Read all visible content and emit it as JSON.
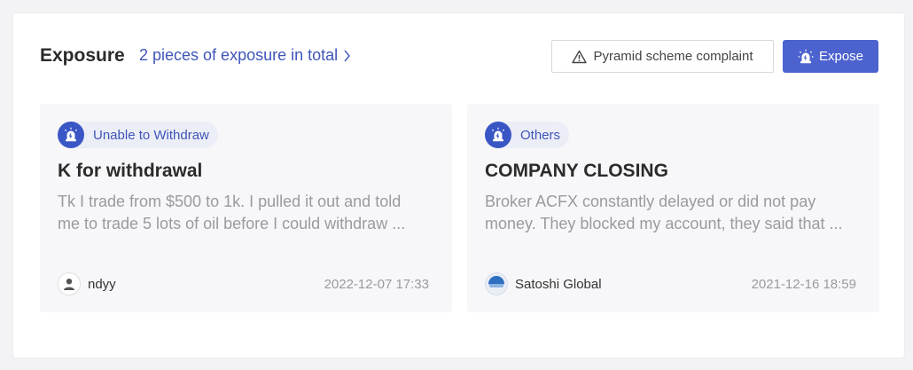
{
  "header": {
    "title": "Exposure",
    "count_link": "2 pieces of exposure in total",
    "complaint_button": "Pyramid scheme complaint",
    "expose_button": "Expose"
  },
  "cards": [
    {
      "tag": "Unable to Withdraw",
      "title": "K for withdrawal",
      "body_line1": "Tk I trade from $500 to 1k. I pulled it out and told",
      "body_line2": "me to trade 5 lots of oil before I could withdraw ...",
      "author": "ndyy",
      "date": "2022-12-07 17:33"
    },
    {
      "tag": "Others",
      "title": "COMPANY CLOSING",
      "body_line1": "Broker ACFX constantly delayed or did not pay",
      "body_line2": "money. They blocked my account, they said that ...",
      "author": "Satoshi Global",
      "date": "2021-12-16 18:59"
    }
  ],
  "colors": {
    "accent": "#4c62cf",
    "link": "#3f55b8",
    "tag_bg": "#eceef7",
    "card_bg": "#f7f7f9"
  }
}
